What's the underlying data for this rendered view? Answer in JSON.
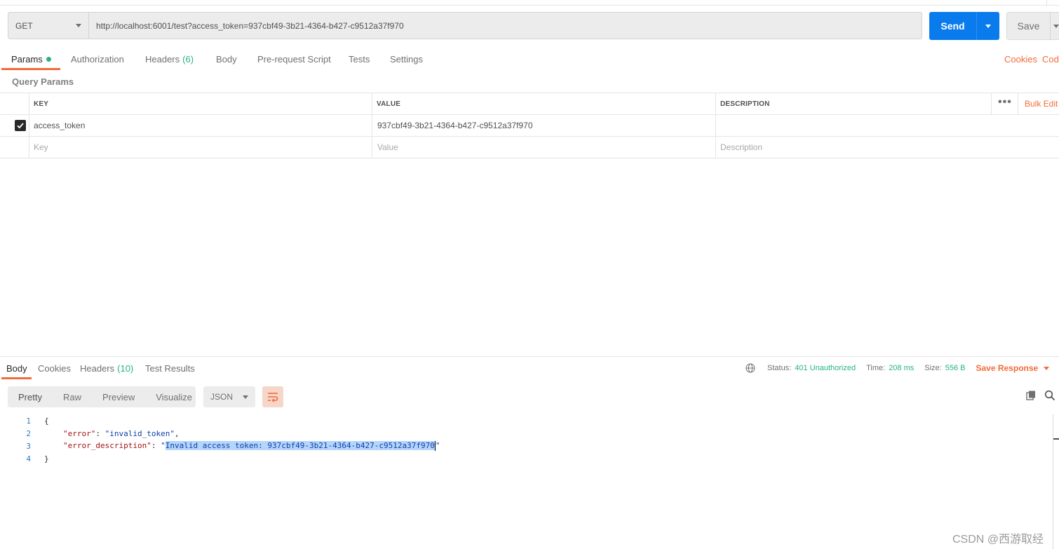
{
  "request": {
    "method": "GET",
    "url": "http://localhost:6001/test?access_token=937cbf49-3b21-4364-b427-c9512a37f970",
    "send_label": "Send",
    "save_label": "Save"
  },
  "request_tabs": {
    "params": "Params",
    "authorization": "Authorization",
    "headers": "Headers",
    "headers_count": "(6)",
    "body": "Body",
    "prerequest": "Pre-request Script",
    "tests": "Tests",
    "settings": "Settings",
    "cookies": "Cookies",
    "code": "Code"
  },
  "query_params": {
    "title": "Query Params",
    "columns": {
      "key": "KEY",
      "value": "VALUE",
      "description": "DESCRIPTION"
    },
    "bulk_edit": "Bulk Edit",
    "rows": [
      {
        "checked": true,
        "key": "access_token",
        "value": "937cbf49-3b21-4364-b427-c9512a37f970",
        "description": ""
      }
    ],
    "placeholders": {
      "key": "Key",
      "value": "Value",
      "description": "Description"
    }
  },
  "response_tabs": {
    "body": "Body",
    "cookies": "Cookies",
    "headers": "Headers",
    "headers_count": "(10)",
    "test_results": "Test Results"
  },
  "response_status": {
    "status_label": "Status:",
    "status_value": "401 Unauthorized",
    "time_label": "Time:",
    "time_value": "208 ms",
    "size_label": "Size:",
    "size_value": "556 B",
    "save_response": "Save Response"
  },
  "response_format": {
    "pretty": "Pretty",
    "raw": "Raw",
    "preview": "Preview",
    "visualize": "Visualize",
    "language": "JSON"
  },
  "response_body": {
    "line_numbers": [
      "1",
      "2",
      "3",
      "4"
    ],
    "open_brace": "{",
    "close_brace": "}",
    "error_key": "\"error\"",
    "error_value": "\"invalid_token\"",
    "desc_key": "\"error_description\"",
    "desc_quote_open": "\"",
    "desc_value": "Invalid access token: 937cbf49-3b21-4364-b427-c9512a37f970",
    "desc_quote_close": "\""
  },
  "colors": {
    "accent": "#f26b3a",
    "send": "#097bed",
    "success": "#26b47f"
  },
  "watermark": "CSDN @西游取经"
}
